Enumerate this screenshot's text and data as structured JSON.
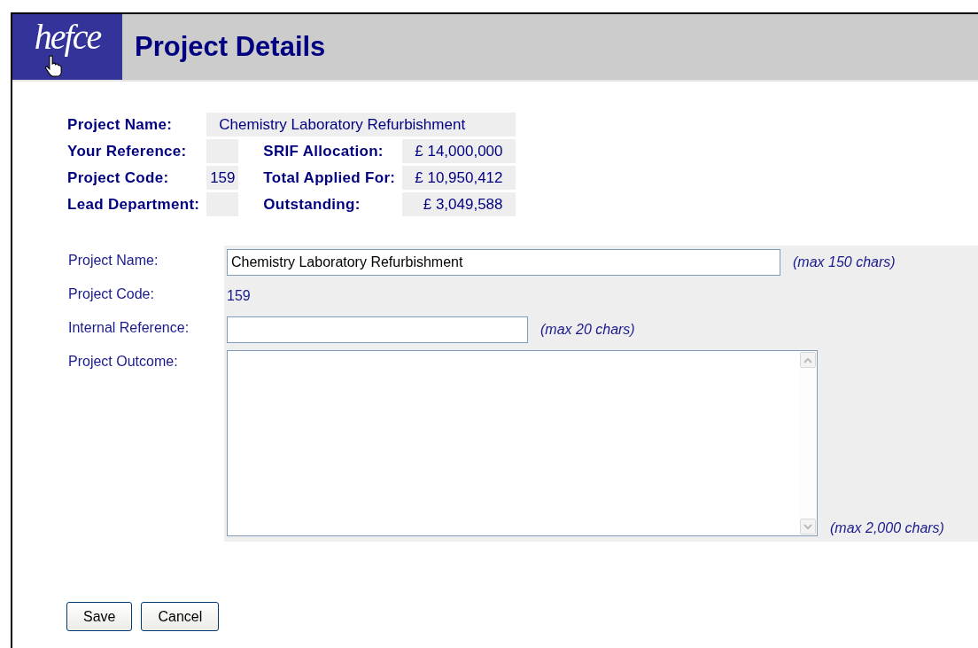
{
  "header": {
    "logo": "hefce",
    "title": "Project Details"
  },
  "summary": {
    "project_name": {
      "label": "Project Name:",
      "value": "Chemistry Laboratory Refurbishment"
    },
    "rows": [
      {
        "label": "Your Reference:",
        "right_label": "SRIF Allocation:",
        "right_value": "£ 14,000,000"
      },
      {
        "label": "Project Code:",
        "value": "159",
        "right_label": "Total Applied For:",
        "right_value": "£ 10,950,412"
      },
      {
        "label": "Lead Department:",
        "right_label": "Outstanding:",
        "right_value": "£ 3,049,588"
      }
    ]
  },
  "form": {
    "fields": [
      {
        "kind": "longtext",
        "label": "Project Name:",
        "value": "Chemistry Laboratory Refurbishment",
        "note": "(max 150 chars)"
      },
      {
        "kind": "static",
        "label": "Project Code:",
        "value": "159"
      },
      {
        "kind": "shorttext",
        "label": "Internal Reference:",
        "note": "(max 20 chars)"
      },
      {
        "kind": "textarea",
        "label": "Project Outcome:",
        "note": "(max 2,000 chars)"
      }
    ]
  },
  "buttons": [
    "Save",
    "Cancel"
  ]
}
